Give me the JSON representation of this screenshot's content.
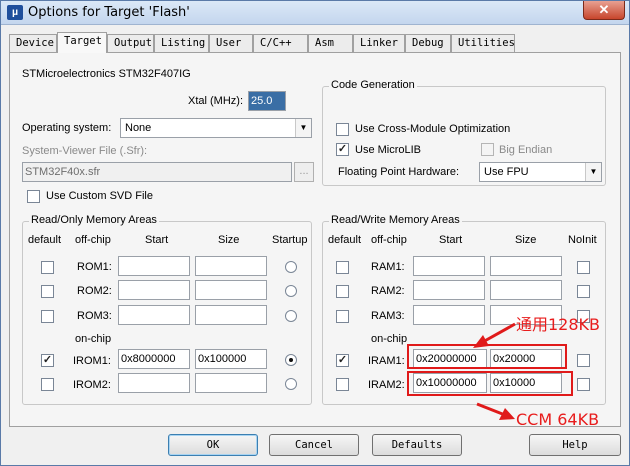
{
  "window": {
    "title": "Options for Target 'Flash'",
    "close_label": "✕"
  },
  "tabs": [
    {
      "label": "Device"
    },
    {
      "label": "Target"
    },
    {
      "label": "Output"
    },
    {
      "label": "Listing"
    },
    {
      "label": "User"
    },
    {
      "label": "C/C++"
    },
    {
      "label": "Asm"
    },
    {
      "label": "Linker"
    },
    {
      "label": "Debug"
    },
    {
      "label": "Utilities"
    }
  ],
  "device": {
    "name": "STMicroelectronics STM32F407IG"
  },
  "xtal": {
    "label": "Xtal (MHz):",
    "value": "25.0"
  },
  "os": {
    "label": "Operating system:",
    "value": "None"
  },
  "svd": {
    "label": "System-Viewer File (.Sfr):",
    "value": "STM32F40x.sfr",
    "browse": "...",
    "custom_label": "Use Custom SVD File"
  },
  "codegen": {
    "title": "Code Generation",
    "cross_module": "Use Cross-Module Optimization",
    "microlib": "Use MicroLIB",
    "big_endian": "Big Endian",
    "fpu_label": "Floating Point Hardware:",
    "fpu_value": "Use FPU"
  },
  "rom": {
    "title": "Read/Only Memory Areas",
    "headers": {
      "default": "default",
      "offchip": "off-chip",
      "start": "Start",
      "size": "Size",
      "startup": "Startup"
    },
    "onchip": "on-chip",
    "rows": [
      {
        "label": "ROM1:",
        "start": "",
        "size": ""
      },
      {
        "label": "ROM2:",
        "start": "",
        "size": ""
      },
      {
        "label": "ROM3:",
        "start": "",
        "size": ""
      },
      {
        "label": "IROM1:",
        "start": "0x8000000",
        "size": "0x100000"
      },
      {
        "label": "IROM2:",
        "start": "",
        "size": ""
      }
    ]
  },
  "ram": {
    "title": "Read/Write Memory Areas",
    "headers": {
      "default": "default",
      "offchip": "off-chip",
      "start": "Start",
      "size": "Size",
      "noinit": "NoInit"
    },
    "onchip": "on-chip",
    "rows": [
      {
        "label": "RAM1:",
        "start": "",
        "size": ""
      },
      {
        "label": "RAM2:",
        "start": "",
        "size": ""
      },
      {
        "label": "RAM3:",
        "start": "",
        "size": ""
      },
      {
        "label": "IRAM1:",
        "start": "0x20000000",
        "size": "0x20000"
      },
      {
        "label": "IRAM2:",
        "start": "0x10000000",
        "size": "0x10000"
      }
    ]
  },
  "annotations": {
    "general": "通用128KB",
    "ccm": "CCM 64KB",
    "color": "#e01a1a"
  },
  "buttons": {
    "ok": "OK",
    "cancel": "Cancel",
    "defaults": "Defaults",
    "help": "Help"
  }
}
